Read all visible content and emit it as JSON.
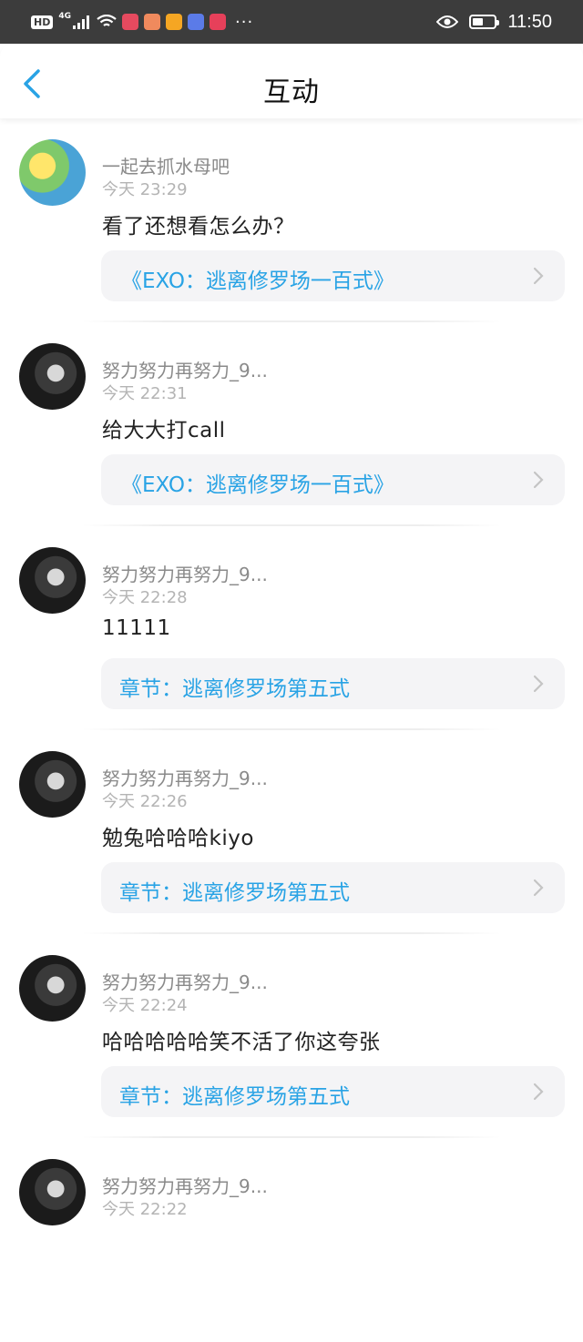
{
  "status_bar": {
    "hd": "HD",
    "network": "4G",
    "overflow": "···",
    "time": "11:50",
    "battery_level": 0.5,
    "icons": [
      "hd-icon",
      "signal-icon",
      "wifi-icon",
      "app-icon",
      "chat-icon",
      "video-icon",
      "music-icon",
      "notify-icon",
      "eye-icon",
      "battery-icon"
    ]
  },
  "header": {
    "title": "互动",
    "back_icon": "chevron-left-icon",
    "accent_color": "#29a3e5"
  },
  "items": [
    {
      "avatar": "spongebob-avatar",
      "username": "一起去抓水母吧",
      "time": "今天 23:29",
      "comment": "看了还想看怎么办？",
      "ref": "《EXO：逃离修罗场一百式》"
    },
    {
      "avatar": "user-avatar",
      "username": "努力努力再努力_9...",
      "time": "今天 22:31",
      "comment": "给大大打call",
      "ref": "《EXO：逃离修罗场一百式》"
    },
    {
      "avatar": "user-avatar",
      "username": "努力努力再努力_9...",
      "time": "今天 22:28",
      "comment": "11111",
      "ref": "章节：逃离修罗场第五式"
    },
    {
      "avatar": "user-avatar",
      "username": "努力努力再努力_9...",
      "time": "今天 22:26",
      "comment": "勉兔哈哈哈kiyo",
      "ref": "章节：逃离修罗场第五式"
    },
    {
      "avatar": "user-avatar",
      "username": "努力努力再努力_9...",
      "time": "今天 22:24",
      "comment": "哈哈哈哈哈笑不活了你这夸张",
      "ref": "章节：逃离修罗场第五式"
    },
    {
      "avatar": "user-avatar",
      "username": "努力努力再努力_9...",
      "time": "今天 22:22",
      "comment": "",
      "ref": ""
    }
  ]
}
